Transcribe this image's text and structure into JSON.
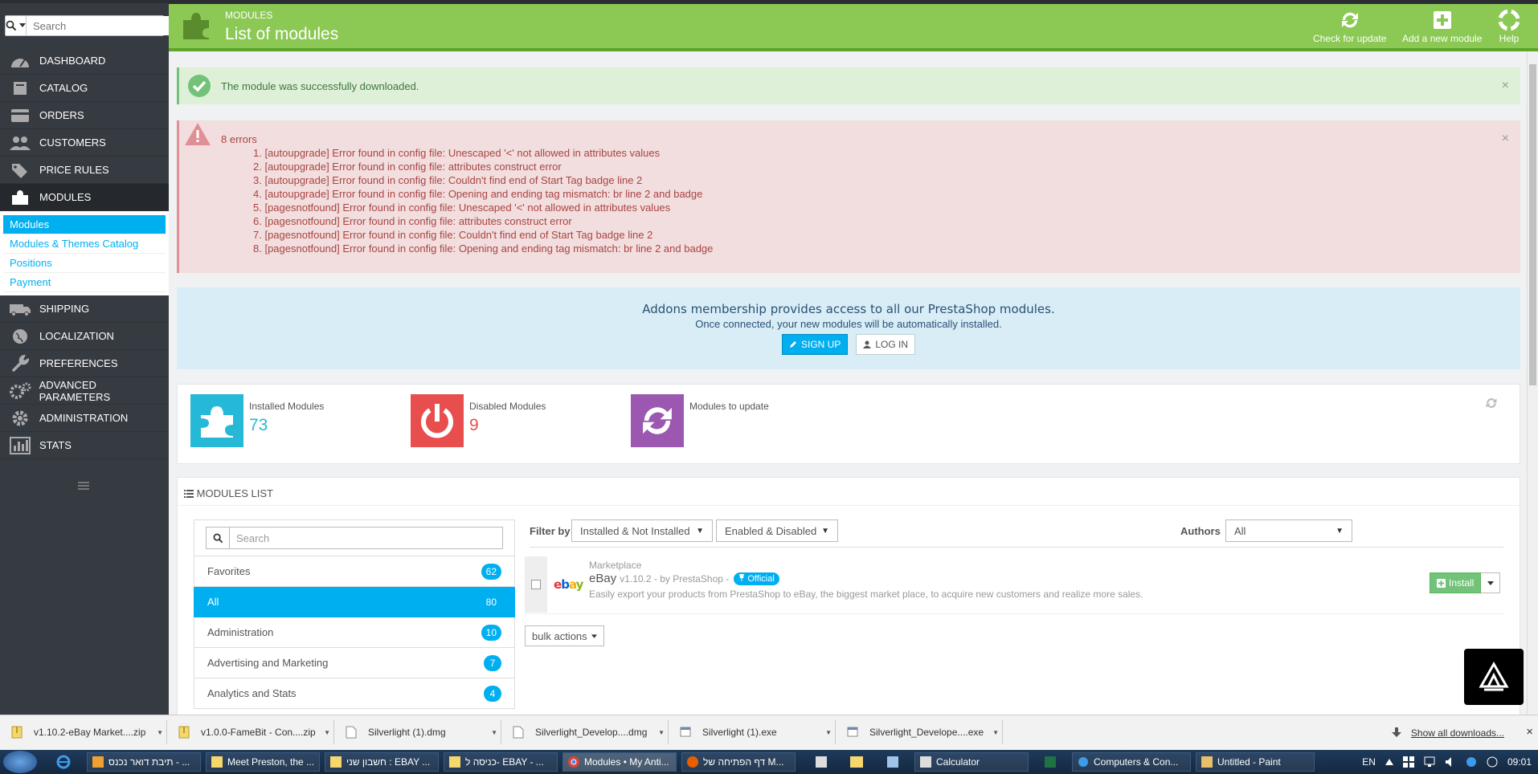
{
  "sidebar": {
    "search_placeholder": "Search",
    "items": [
      {
        "label": "DASHBOARD",
        "icon": "dashboard-icon"
      },
      {
        "label": "CATALOG",
        "icon": "book-icon"
      },
      {
        "label": "ORDERS",
        "icon": "credit-card-icon"
      },
      {
        "label": "CUSTOMERS",
        "icon": "users-icon"
      },
      {
        "label": "PRICE RULES",
        "icon": "tags-icon"
      },
      {
        "label": "MODULES",
        "icon": "puzzle-icon"
      },
      {
        "label": "SHIPPING",
        "icon": "truck-icon"
      },
      {
        "label": "LOCALIZATION",
        "icon": "globe-icon"
      },
      {
        "label": "PREFERENCES",
        "icon": "wrench-icon"
      },
      {
        "label": "ADVANCED PARAMETERS",
        "icon": "cogs-icon"
      },
      {
        "label": "ADMINISTRATION",
        "icon": "cog-icon"
      },
      {
        "label": "STATS",
        "icon": "bar-chart-icon"
      }
    ],
    "submenu": [
      "Modules",
      "Modules & Themes Catalog",
      "Positions",
      "Payment"
    ]
  },
  "header": {
    "breadcrumb": "MODULES",
    "title": "List of modules",
    "toolbar": {
      "check_update": "Check for update",
      "add_module": "Add a new module",
      "help": "Help"
    }
  },
  "alerts": {
    "success": "The module was successfully downloaded.",
    "error_title": "8 errors",
    "errors": [
      "1.   [autoupgrade] Error found in config file: Unescaped '<' not allowed in attributes values",
      "2.   [autoupgrade] Error found in config file: attributes construct error",
      "3.   [autoupgrade] Error found in config file: Couldn't find end of Start Tag badge line 2",
      "4.   [autoupgrade] Error found in config file: Opening and ending tag mismatch: br line 2 and badge",
      "5.   [pagesnotfound] Error found in config file: Unescaped '<' not allowed in attributes values",
      "6.   [pagesnotfound] Error found in config file: attributes construct error",
      "7.   [pagesnotfound] Error found in config file: Couldn't find end of Start Tag badge line 2",
      "8.   [pagesnotfound] Error found in config file: Opening and ending tag mismatch: br line 2 and badge"
    ],
    "close": "×"
  },
  "addons": {
    "line1": "Addons membership provides access to all our PrestaShop modules.",
    "line2": "Once connected, your new modules will be automatically installed.",
    "signup": "SIGN UP",
    "login": "LOG IN"
  },
  "stats": {
    "installed_label": "Installed Modules",
    "installed_value": "73",
    "disabled_label": "Disabled Modules",
    "disabled_value": "9",
    "update_label": "Modules to update",
    "colors": {
      "installed": "#25b9d7",
      "disabled": "#e84e4e",
      "update": "#9c58b0"
    }
  },
  "modules_list": {
    "title": "MODULES LIST",
    "search_placeholder": "Search",
    "categories": [
      {
        "name": "Favorites",
        "count": "62"
      },
      {
        "name": "All",
        "count": "80"
      },
      {
        "name": "Administration",
        "count": "10"
      },
      {
        "name": "Advertising and Marketing",
        "count": "7"
      },
      {
        "name": "Analytics and Stats",
        "count": "4"
      }
    ],
    "filter_by": "Filter by",
    "filter_install": "Installed & Not Installed",
    "filter_enabled": "Enabled & Disabled",
    "authors_label": "Authors",
    "authors_value": "All",
    "module": {
      "category": "Marketplace",
      "name": "eBay",
      "version": "v1.10.2 - by PrestaShop -",
      "official": "Official",
      "description": "Easily export your products from PrestaShop to eBay, the biggest market place, to acquire new customers and realize more sales.",
      "install": "Install"
    },
    "bulk": "bulk actions"
  },
  "downloads": {
    "items": [
      "v1.10.2-eBay Market....zip",
      "v1.0.0-FameBit - Con....zip",
      "Silverlight (1).dmg",
      "Silverlight_Develop....dmg",
      "Silverlight (1).exe",
      "Silverlight_Develope....exe"
    ],
    "show_all": "Show all downloads...",
    "close": "×"
  },
  "taskbar": {
    "items": [
      "תיבת דואר נכנס - ...",
      "Meet Preston, the ...",
      "חשבון שני : EBAY ...",
      "כניסה ל- EBAY - ...",
      "Modules • My Anti...",
      "דף הפתיחה של M...",
      "",
      "",
      "",
      "Calculator",
      "",
      "Computers & Con...",
      "Untitled - Paint"
    ],
    "lang": "EN",
    "time": "09:01"
  }
}
